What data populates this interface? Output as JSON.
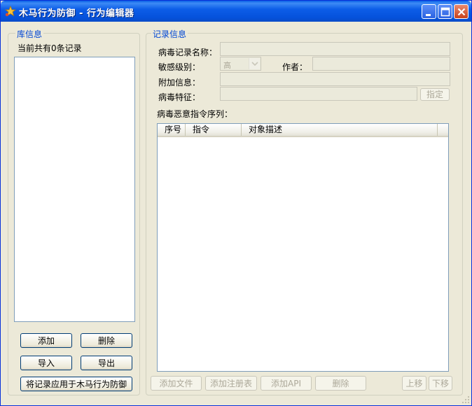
{
  "window": {
    "title": "木马行为防御 - 行为编辑器"
  },
  "library": {
    "group_label": "库信息",
    "record_count_text": "当前共有0条记录",
    "buttons": {
      "add": "添加",
      "delete": "删除",
      "import": "导入",
      "export": "导出",
      "apply": "将记录应用于木马行为防御"
    }
  },
  "record": {
    "group_label": "记录信息",
    "name_label": "病毒记录名称：",
    "name_value": "",
    "sensitivity_label": "敏感级别：",
    "sensitivity_value": "高",
    "author_label": "作者：",
    "author_value": "",
    "extra_label": "附加信息：",
    "extra_value": "",
    "signature_label": "病毒特征：",
    "signature_value": "",
    "specify_button": "指定",
    "sequence_label": "病毒恶意指令序列：",
    "columns": [
      "序号",
      "指令",
      "对象描述"
    ],
    "rows": [],
    "buttons": {
      "add_file": "添加文件",
      "add_registry": "添加注册表",
      "add_api": "添加API",
      "delete": "删除",
      "move_up": "上移",
      "move_down": "下移"
    }
  },
  "colors": {
    "titlebar": "#0a5fe6",
    "group_label": "#0046d5",
    "disabled_text": "#aca899"
  }
}
